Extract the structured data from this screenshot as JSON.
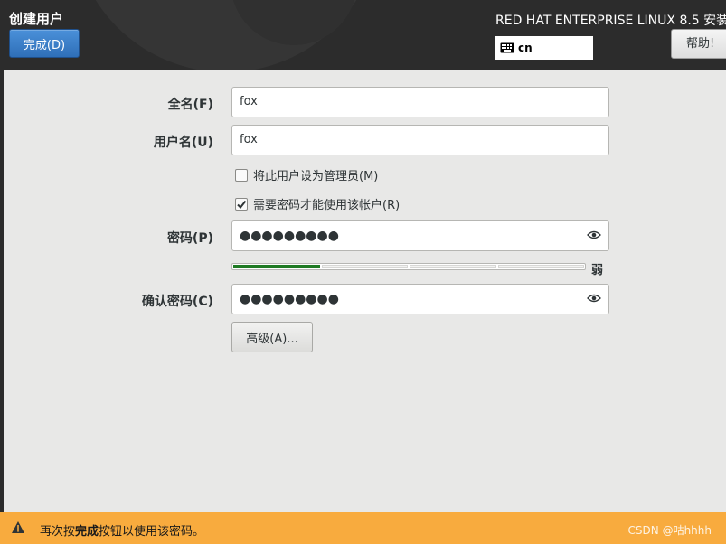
{
  "header": {
    "spoke_title": "创建用户",
    "done_button": "完成(D)",
    "product_title": "RED HAT ENTERPRISE LINUX 8.5 安装",
    "keyboard_layout": "cn",
    "help_button": "帮助!"
  },
  "form": {
    "fullname_label": "全名(F)",
    "fullname_value": "fox",
    "username_label": "用户名(U)",
    "username_value": "fox",
    "admin_checkbox_label": "将此用户设为管理员(M)",
    "admin_checked": false,
    "require_password_label": "需要密码才能使用该帐户(R)",
    "require_password_checked": true,
    "password_label": "密码(P)",
    "password_value": "●●●●●●●●●",
    "strength_level": 0.25,
    "strength_text": "弱",
    "confirm_label": "确认密码(C)",
    "confirm_value": "●●●●●●●●●",
    "advanced_button": "高级(A)..."
  },
  "infobar": {
    "prefix": "再次按",
    "bold": "完成",
    "suffix": "按钮以使用该密码。",
    "watermark": "CSDN @咕hhhh"
  },
  "colors": {
    "header_bg": "#2c2c2c",
    "done_button": "#3a7fcb",
    "strength_bar": "#1f7a24",
    "infobar_bg": "#f8ab3e"
  },
  "icons": [
    "keyboard-icon",
    "eye-icon",
    "warning-icon",
    "checkmark-icon"
  ]
}
